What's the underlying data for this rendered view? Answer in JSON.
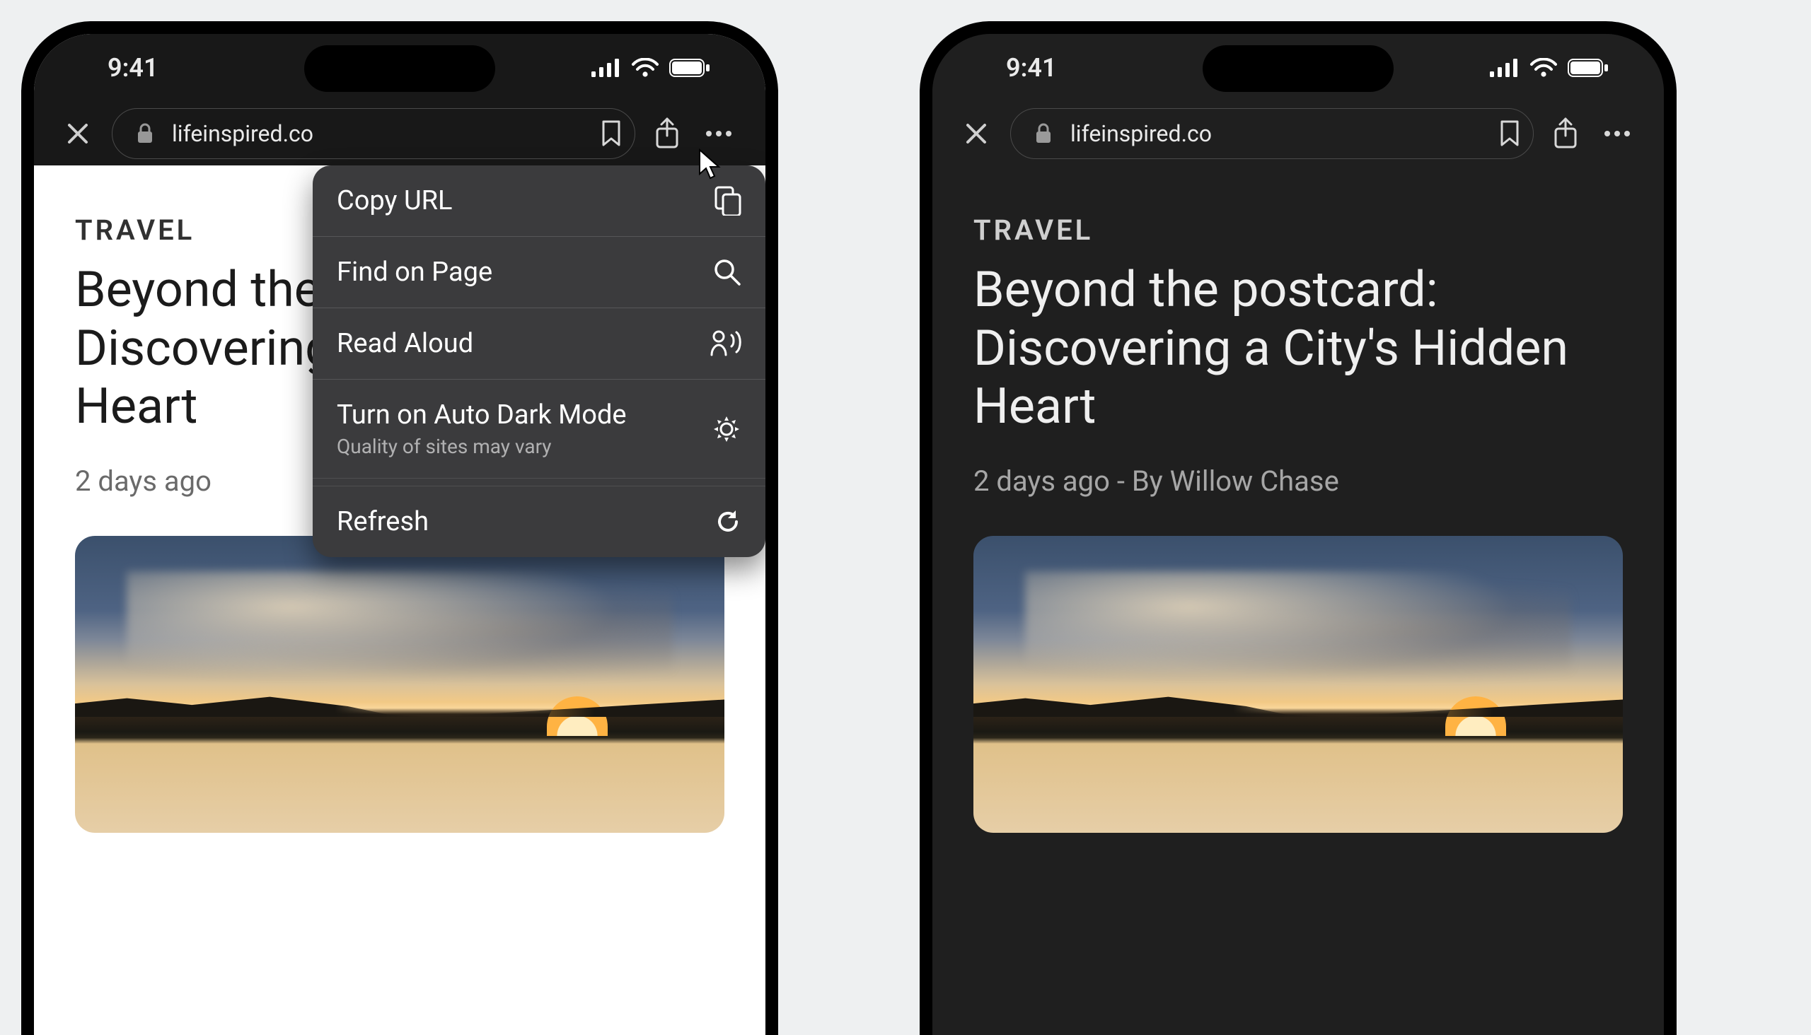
{
  "status": {
    "time": "9:41"
  },
  "toolbar": {
    "url": "lifeinspired.co"
  },
  "article": {
    "category": "TRAVEL",
    "headline": "Beyond the postcard: Discovering a City's Hidden Heart",
    "time_ago": "2 days ago",
    "by_prefix": "By",
    "author": "Willow Chase"
  },
  "menu": {
    "items": [
      {
        "id": "copy-url",
        "label": "Copy URL",
        "icon": "copy-icon"
      },
      {
        "id": "find",
        "label": "Find on Page",
        "icon": "search-icon"
      },
      {
        "id": "read-aloud",
        "label": "Read Aloud",
        "icon": "speak-icon"
      },
      {
        "id": "dark-mode",
        "label": "Turn on Auto Dark Mode",
        "sub": "Quality of sites may vary",
        "icon": "brightness-icon"
      },
      {
        "id": "refresh",
        "label": "Refresh",
        "icon": "refresh-icon"
      }
    ]
  },
  "colors": {
    "accent": "#8ab4f8"
  }
}
